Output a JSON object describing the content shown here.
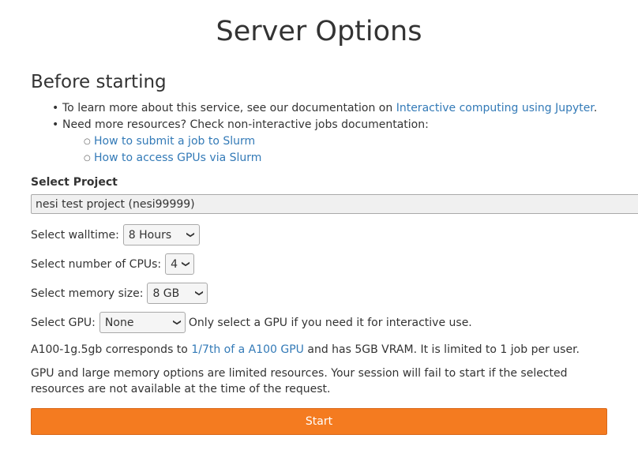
{
  "page_title": "Server Options",
  "before": {
    "heading": "Before starting",
    "item1_text": "To learn more about this service, see our documentation on",
    "item1_link": "Interactive computing using Jupyter",
    "item1_suffix": ".",
    "item2_text": "Need more resources? Check non-interactive jobs documentation:",
    "sub_links": [
      "How to submit a job to Slurm",
      "How to access GPUs via Slurm"
    ]
  },
  "project": {
    "label": "Select Project",
    "value": "nesi test project (nesi99999)"
  },
  "walltime": {
    "label": "Select walltime:",
    "value": "8 Hours"
  },
  "cpus": {
    "label": "Select number of CPUs:",
    "value": "4"
  },
  "memory": {
    "label": "Select memory size:",
    "value": "8 GB"
  },
  "gpu": {
    "label": "Select GPU:",
    "value": "None",
    "hint": "Only select a GPU if you need it for interactive use."
  },
  "gpu_info": {
    "prefix": "A100-1g.5gb corresponds to",
    "link": "1/7th of a A100 GPU",
    "suffix": "and has 5GB VRAM. It is limited to 1 job per user."
  },
  "warning": "GPU and large memory options are limited resources. Your session will fail to start if the selected resources are not available at the time of the request.",
  "start_label": "Start",
  "colors": {
    "accent": "#f47b20",
    "link": "#337ab7"
  }
}
